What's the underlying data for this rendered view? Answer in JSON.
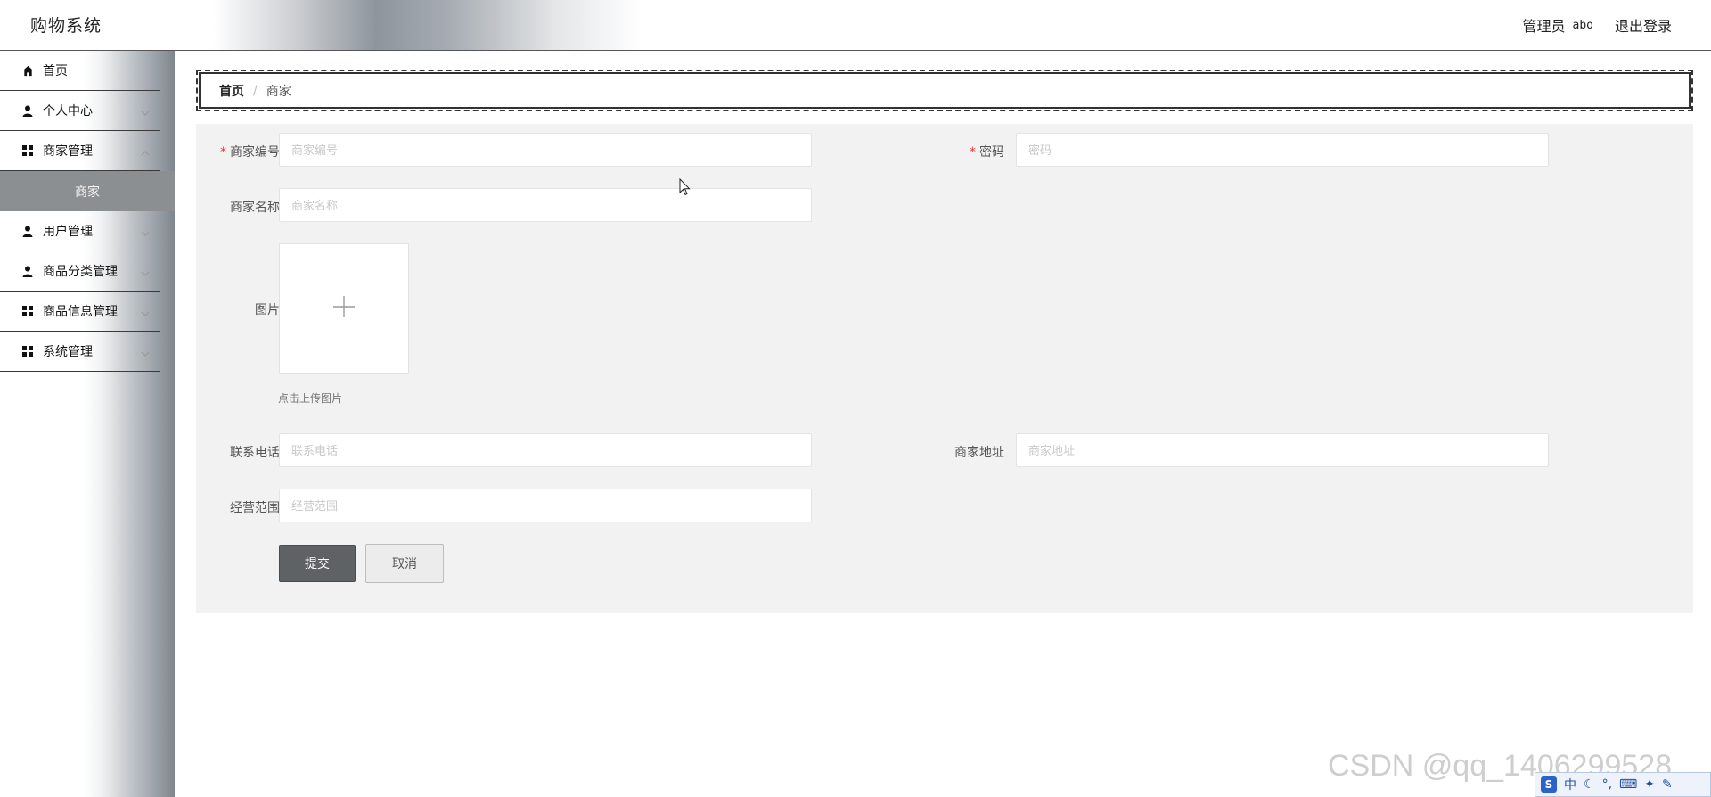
{
  "header": {
    "app_title": "购物系统",
    "role_label": "管理员",
    "username": "abo",
    "logout_label": "退出登录"
  },
  "sidebar": {
    "items": [
      {
        "label": "首页",
        "icon": "home-icon"
      },
      {
        "label": "个人中心",
        "icon": "user-icon"
      },
      {
        "label": "商家管理",
        "icon": "grid-icon"
      },
      {
        "label": "用户管理",
        "icon": "user-icon"
      },
      {
        "label": "商品分类管理",
        "icon": "user-icon"
      },
      {
        "label": "商品信息管理",
        "icon": "grid-icon"
      },
      {
        "label": "系统管理",
        "icon": "grid-icon"
      }
    ],
    "submenu_active": "商家"
  },
  "breadcrumb": {
    "home": "首页",
    "separator": "/",
    "current": "商家"
  },
  "form": {
    "merchant_no": {
      "label": "商家编号",
      "placeholder": "商家编号",
      "required": true
    },
    "password": {
      "label": "密码",
      "placeholder": "密码",
      "required": true
    },
    "merchant_name": {
      "label": "商家名称",
      "placeholder": "商家名称"
    },
    "image": {
      "label": "图片",
      "hint": "点击上传图片"
    },
    "phone": {
      "label": "联系电话",
      "placeholder": "联系电话"
    },
    "address": {
      "label": "商家地址",
      "placeholder": "商家地址"
    },
    "scope": {
      "label": "经营范围",
      "placeholder": "经营范围"
    },
    "submit_label": "提交",
    "cancel_label": "取消",
    "required_mark": "*"
  },
  "overlay": {
    "watermark": "CSDN @qq_1406299528",
    "ime_text": "中"
  },
  "colors": {
    "submenu_bg": "#8c8f92",
    "submit_bg": "#5f6265",
    "form_bg": "#f2f2f2",
    "required": "#e0393e"
  }
}
